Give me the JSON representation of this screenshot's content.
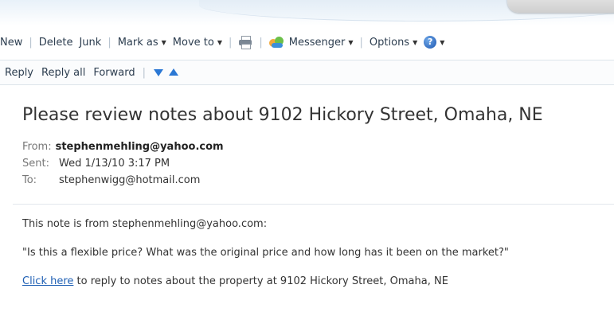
{
  "toolbar": {
    "new_label": "New",
    "delete_label": "Delete",
    "junk_label": "Junk",
    "mark_as_label": "Mark as",
    "move_to_label": "Move to",
    "print_icon": "printer-icon",
    "messenger_label": "Messenger",
    "options_label": "Options",
    "help_icon": "help-icon",
    "caret": "▼"
  },
  "replybar": {
    "reply_label": "Reply",
    "reply_all_label": "Reply all",
    "forward_label": "Forward",
    "prev_icon": "arrow-down-icon",
    "next_icon": "arrow-up-icon"
  },
  "message": {
    "subject": "Please review notes about 9102 Hickory Street, Omaha, NE",
    "from_label": "From:",
    "from_value": "stephenmehling@yahoo.com",
    "sent_label": "Sent:",
    "sent_value": "Wed 1/13/10 3:17 PM",
    "to_label": "To:",
    "to_value": "stephenwigg@hotmail.com",
    "body_intro": "This note is from stephenmehling@yahoo.com:",
    "body_quote": "\"Is this a flexible price? What was the original price and how long has it been on the market?\"",
    "link_text": "Click here",
    "link_suffix": " to reply to notes about the property at 9102 Hickory Street, Omaha, NE"
  },
  "colors": {
    "link": "#1e5fb4",
    "toolbar_text": "#2d3e50",
    "accent_blue": "#2b78d4"
  }
}
